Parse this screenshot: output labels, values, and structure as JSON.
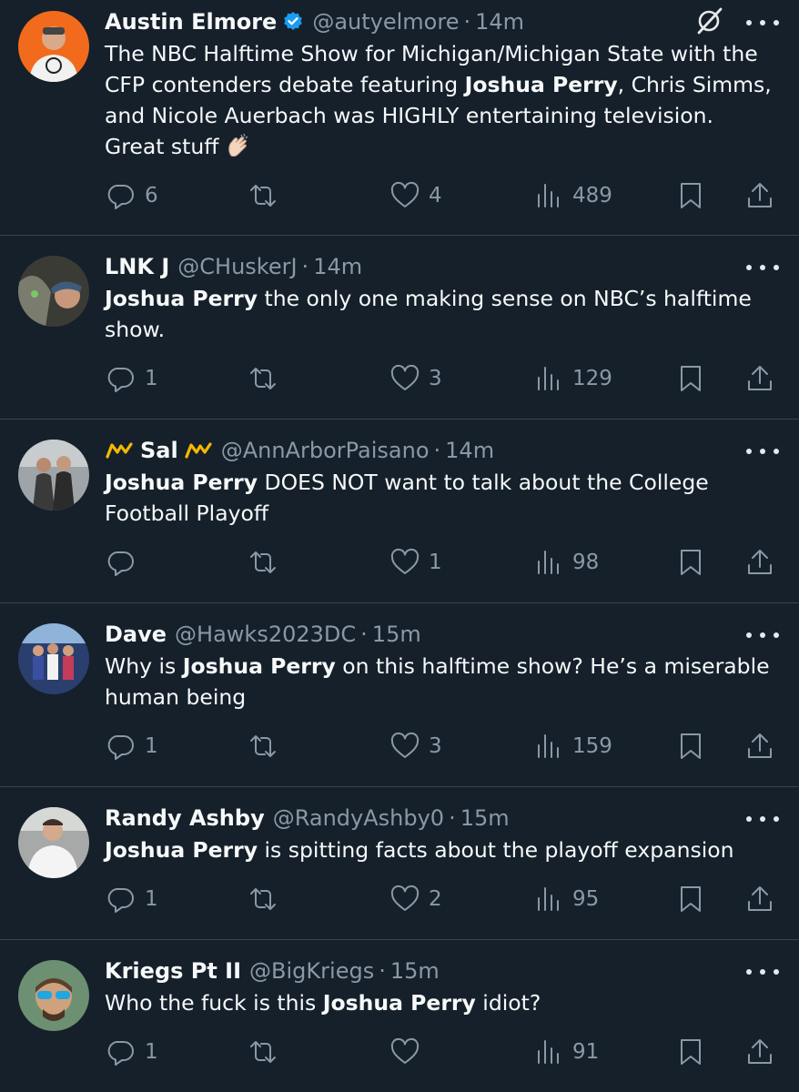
{
  "colors": {
    "background": "#15202b",
    "text": "#f7f9f9",
    "muted": "#8b98a5",
    "verified": "#1d9bf0",
    "crown": "#f5b800",
    "divider": "#38444d"
  },
  "tweets": [
    {
      "name": "Austin Elmore",
      "handle": "@autyelmore",
      "time": "14m",
      "verified": true,
      "avatar_icon": "profile-avatar",
      "text_parts": [
        "The NBC Halftime Show for Michigan/Michigan State with the CFP contenders debate featuring ",
        "Joshua Perry",
        ", Chris Simms, and Nicole Auerbach was HIGHLY entertaining television. Great stuff"
      ],
      "emoji": "clapping-hands-icon",
      "replies": "6",
      "retweets": "",
      "likes": "4",
      "views": "489"
    },
    {
      "name": "LNK J",
      "handle": "@CHuskerJ",
      "time": "14m",
      "avatar_icon": "profile-avatar",
      "text_parts": [
        "",
        "Joshua Perry",
        " the only one making sense on NBC’s halftime show."
      ],
      "replies": "1",
      "retweets": "",
      "likes": "3",
      "views": "129"
    },
    {
      "name": "Sal",
      "handle": "@AnnArborPaisano",
      "time": "14m",
      "crowns": "crown-icon",
      "avatar_icon": "profile-avatar",
      "text_parts": [
        "",
        "Joshua Perry",
        " DOES NOT want to talk about the College Football Playoff"
      ],
      "replies": "",
      "retweets": "",
      "likes": "1",
      "views": "98"
    },
    {
      "name": "Dave",
      "handle": "@Hawks2023DC",
      "time": "15m",
      "avatar_icon": "profile-avatar",
      "text_parts": [
        "Why is ",
        "Joshua Perry",
        " on this halftime show? He’s a miserable human being"
      ],
      "replies": "1",
      "retweets": "",
      "likes": "3",
      "views": "159"
    },
    {
      "name": "Randy Ashby",
      "handle": "@RandyAshby0",
      "time": "15m",
      "avatar_icon": "profile-avatar",
      "text_parts": [
        "",
        "Joshua Perry",
        " is spitting facts about the playoff expansion"
      ],
      "replies": "1",
      "retweets": "",
      "likes": "2",
      "views": "95"
    },
    {
      "name": "Kriegs Pt II",
      "handle": "@BigKriegs",
      "time": "15m",
      "avatar_icon": "profile-avatar",
      "text_parts": [
        "Who the fuck is this ",
        "Joshua Perry",
        " idiot?"
      ],
      "replies": "1",
      "retweets": "",
      "likes": "",
      "views": "91"
    }
  ]
}
